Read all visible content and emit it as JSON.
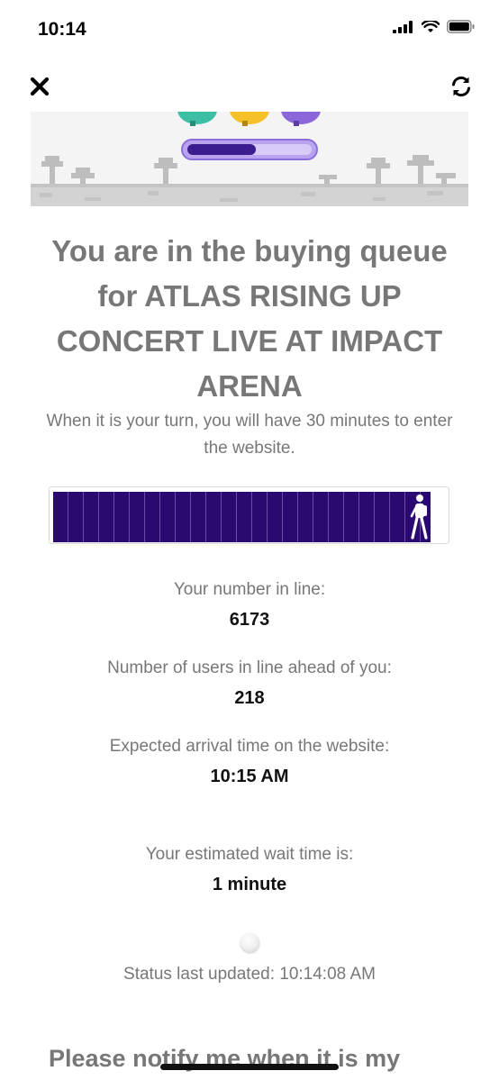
{
  "status_bar": {
    "time": "10:14"
  },
  "hero": {
    "progress": 0.55
  },
  "queue": {
    "title": "You are in the buying queue for ATLAS RISING UP CONCERT LIVE AT IMPACT ARENA",
    "subtitle": "When it is your turn, you will have 30 minutes to enter the website.",
    "progress": 1.0
  },
  "info": {
    "number_label": "Your number in line:",
    "number_value": "6173",
    "ahead_label": "Number of users in line ahead of you:",
    "ahead_value": "218",
    "arrival_label": "Expected arrival time on the website:",
    "arrival_value": "10:15 AM",
    "wait_label": "Your estimated wait time is:",
    "wait_value": "1 minute"
  },
  "status_updated": "Status last updated: 10:14:08 AM",
  "notify_text": "Please notify me when it is my",
  "icons": {
    "close": "close-icon",
    "refresh": "refresh-icon",
    "signal": "signal-icon",
    "wifi": "wifi-icon",
    "battery": "battery-icon",
    "walker": "hiker-icon"
  },
  "colors": {
    "progress_fill": "#2a0a70",
    "hero_bar": "#3b1d8f",
    "text_gray": "#777777"
  }
}
